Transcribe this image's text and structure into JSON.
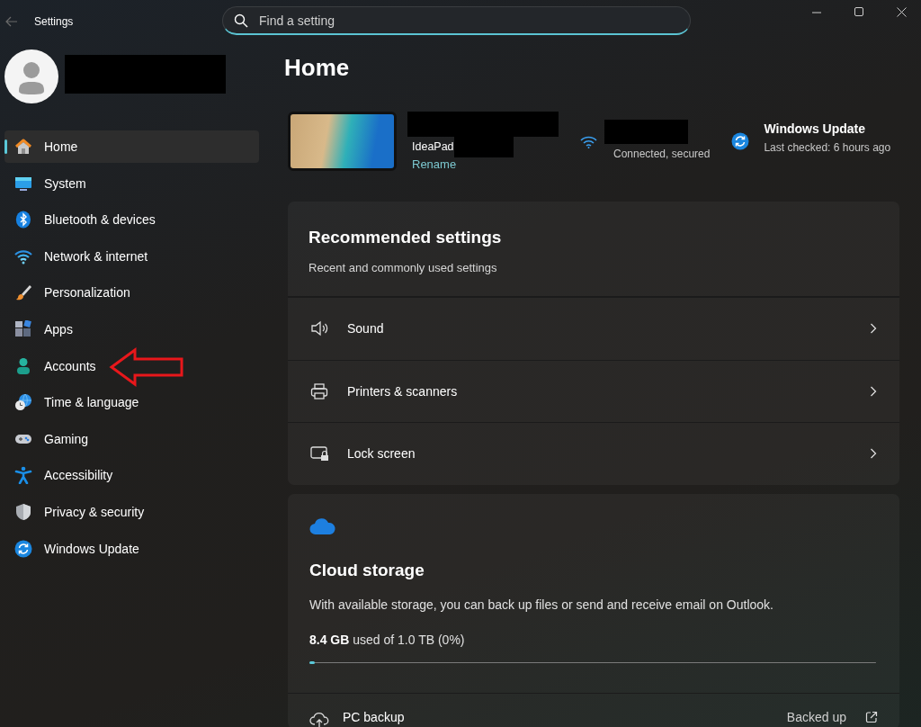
{
  "window": {
    "title": "Settings"
  },
  "search": {
    "placeholder": "Find a setting"
  },
  "sidebar": {
    "items": [
      {
        "label": "Home",
        "selected": true
      },
      {
        "label": "System",
        "selected": false
      },
      {
        "label": "Bluetooth & devices",
        "selected": false
      },
      {
        "label": "Network & internet",
        "selected": false
      },
      {
        "label": "Personalization",
        "selected": false
      },
      {
        "label": "Apps",
        "selected": false
      },
      {
        "label": "Accounts",
        "selected": false
      },
      {
        "label": "Time & language",
        "selected": false
      },
      {
        "label": "Gaming",
        "selected": false
      },
      {
        "label": "Accessibility",
        "selected": false
      },
      {
        "label": "Privacy & security",
        "selected": false
      },
      {
        "label": "Windows Update",
        "selected": false
      }
    ]
  },
  "page": {
    "title": "Home"
  },
  "device": {
    "model": "IdeaPad",
    "rename": "Rename"
  },
  "network": {
    "status": "Connected, secured"
  },
  "update": {
    "title": "Windows Update",
    "status": "Last checked: 6 hours ago"
  },
  "recommended": {
    "title": "Recommended settings",
    "subtitle": "Recent and commonly used settings",
    "items": [
      {
        "label": "Sound"
      },
      {
        "label": "Printers & scanners"
      },
      {
        "label": "Lock screen"
      }
    ]
  },
  "cloud": {
    "title": "Cloud storage",
    "description": "With available storage, you can back up files or send and receive email on Outlook.",
    "usage": "**8.4 GB** used of 1.0 TB (0%)",
    "level": 0.01,
    "rows": [
      {
        "label": "PC backup",
        "status": "Backed up"
      }
    ]
  }
}
